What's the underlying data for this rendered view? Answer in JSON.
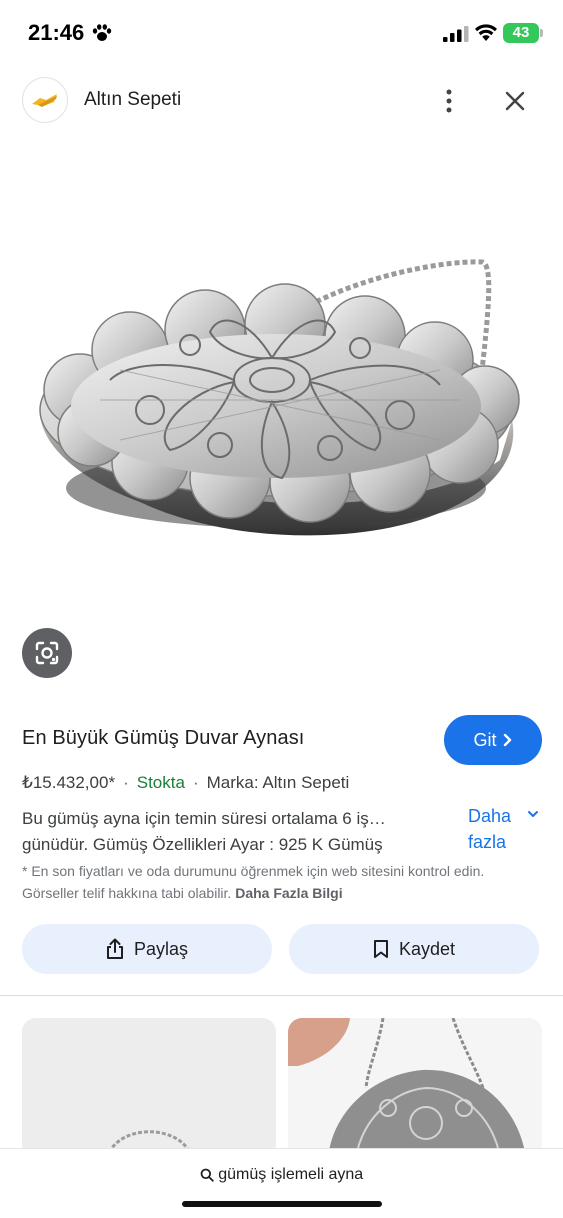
{
  "status_bar": {
    "time": "21:46",
    "battery": "43"
  },
  "header": {
    "site_name": "Altın Sepeti"
  },
  "product": {
    "title": "En Büyük Gümüş Duvar Aynası",
    "visit_label": "Git",
    "price": "₺15.432,00*",
    "stock": "Stokta",
    "brand": "Marka: Altın Sepeti",
    "description_line1": "Bu gümüş ayna için temin süresi ortalama 6 iş…",
    "description_line2": "günüdür. Gümüş Özellikleri Ayar : 925 K Gümüş",
    "more_label_1": "Daha",
    "more_label_2": "fazla",
    "disclaimer": "* En son fiyatları ve oda durumunu öğrenmek için web sitesini kontrol edin. Görseller telif hakkına tabi olabilir.",
    "disclaimer_link": "Daha Fazla Bilgi"
  },
  "actions": {
    "share_label": "Paylaş",
    "save_label": "Kaydet"
  },
  "search": {
    "query": "gümüş işlemeli ayna"
  },
  "colors": {
    "accent": "#1a73e8",
    "stock": "#188038",
    "action_bg": "#e8f0fe",
    "battery": "#34c759"
  },
  "icons": [
    "paw-icon",
    "signal-icon",
    "wifi-icon",
    "site-logo-icon",
    "more-vertical-icon",
    "close-icon",
    "lens-icon",
    "chevron-right-icon",
    "chevron-down-icon",
    "share-icon",
    "bookmark-icon",
    "search-icon"
  ]
}
